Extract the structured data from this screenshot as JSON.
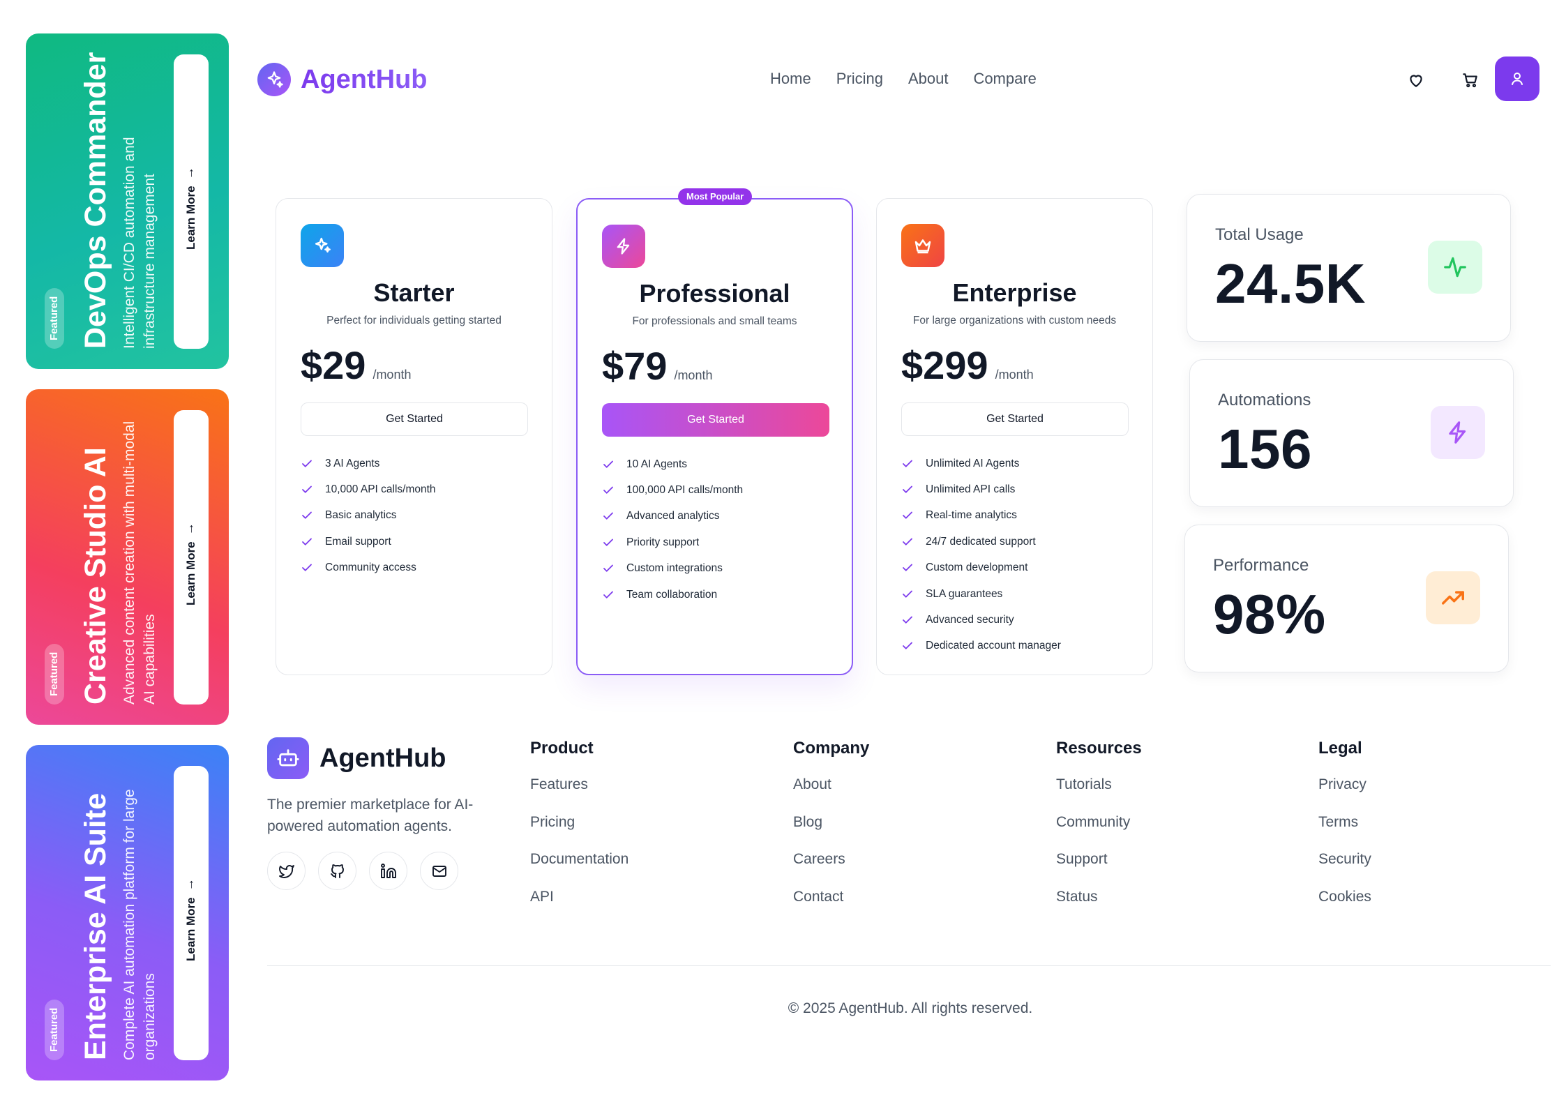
{
  "featured": [
    {
      "badge": "Featured",
      "title": "DevOps Commander",
      "description": "Intelligent CI/CD automation and infrastructure management",
      "button": "Learn More"
    },
    {
      "badge": "Featured",
      "title": "Creative Studio AI",
      "description": "Advanced content creation with multi-modal AI capabilities",
      "button": "Learn More"
    },
    {
      "badge": "Featured",
      "title": "Enterprise AI Suite",
      "description": "Complete AI automation platform for large organizations",
      "button": "Learn More"
    }
  ],
  "header": {
    "logo": "AgentHub",
    "nav": [
      "Home",
      "Pricing",
      "About",
      "Compare"
    ]
  },
  "pricing": [
    {
      "name": "Starter",
      "subtitle": "Perfect for individuals getting started",
      "price": "$29",
      "period": "/month",
      "cta": "Get Started",
      "features": [
        "3 AI Agents",
        "10,000 API calls/month",
        "Basic analytics",
        "Email support",
        "Community access"
      ]
    },
    {
      "badge": "Most Popular",
      "name": "Professional",
      "subtitle": "For professionals and small teams",
      "price": "$79",
      "period": "/month",
      "cta": "Get Started",
      "features": [
        "10 AI Agents",
        "100,000 API calls/month",
        "Advanced analytics",
        "Priority support",
        "Custom integrations",
        "Team collaboration"
      ]
    },
    {
      "name": "Enterprise",
      "subtitle": "For large organizations with custom needs",
      "price": "$299",
      "period": "/month",
      "cta": "Get Started",
      "features": [
        "Unlimited AI Agents",
        "Unlimited API calls",
        "Real-time analytics",
        "24/7 dedicated support",
        "Custom development",
        "SLA guarantees",
        "Advanced security",
        "Dedicated account manager"
      ]
    }
  ],
  "stats": [
    {
      "label": "Total Usage",
      "value": "24.5K",
      "icon": "activity-icon",
      "color": "#22c55e"
    },
    {
      "label": "Automations",
      "value": "156",
      "icon": "zap-icon",
      "color": "#a855f7"
    },
    {
      "label": "Performance",
      "value": "98%",
      "icon": "trending-up-icon",
      "color": "#f97316"
    }
  ],
  "footer": {
    "brand": "AgentHub",
    "tagline": "The premier marketplace for AI-powered automation agents.",
    "columns": [
      {
        "title": "Product",
        "links": [
          "Features",
          "Pricing",
          "Documentation",
          "API"
        ]
      },
      {
        "title": "Company",
        "links": [
          "About",
          "Blog",
          "Careers",
          "Contact"
        ]
      },
      {
        "title": "Resources",
        "links": [
          "Tutorials",
          "Community",
          "Support",
          "Status"
        ]
      },
      {
        "title": "Legal",
        "links": [
          "Privacy",
          "Terms",
          "Security",
          "Cookies"
        ]
      }
    ],
    "copyright": "© 2025 AgentHub. All rights reserved."
  },
  "colors": {
    "brand": "#7c3aed",
    "accent_pink": "#ec4899"
  }
}
